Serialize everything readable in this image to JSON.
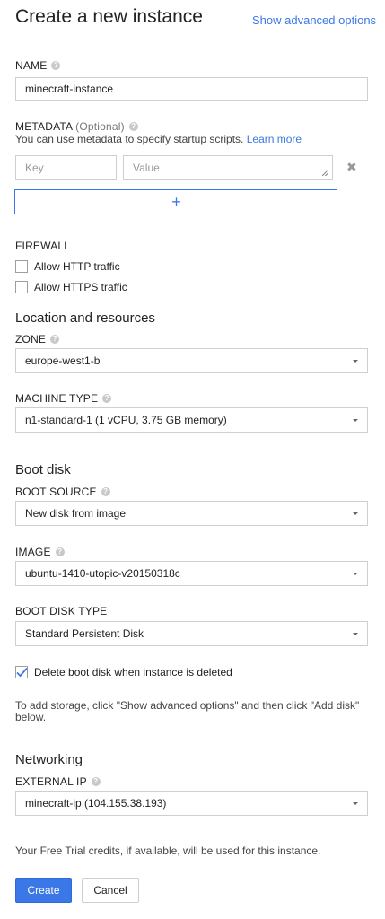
{
  "header": {
    "title": "Create a new instance",
    "advanced_link": "Show advanced options"
  },
  "name": {
    "label": "NAME",
    "value": "minecraft-instance"
  },
  "metadata": {
    "label": "METADATA",
    "optional": "(Optional)",
    "description": "You can use metadata to specify startup scripts.",
    "learn_more": "Learn more",
    "key_placeholder": "Key",
    "value_placeholder": "Value",
    "add_symbol": "+"
  },
  "firewall": {
    "label": "FIREWALL",
    "http_label": "Allow HTTP traffic",
    "http_checked": false,
    "https_label": "Allow HTTPS traffic",
    "https_checked": false
  },
  "location": {
    "heading": "Location and resources",
    "zone_label": "ZONE",
    "zone_value": "europe-west1-b",
    "machine_type_label": "MACHINE TYPE",
    "machine_type_value": "n1-standard-1 (1 vCPU, 3.75 GB memory)"
  },
  "boot_disk": {
    "heading": "Boot disk",
    "source_label": "BOOT SOURCE",
    "source_value": "New disk from image",
    "image_label": "IMAGE",
    "image_value": "ubuntu-1410-utopic-v20150318c",
    "type_label": "BOOT DISK TYPE",
    "type_value": "Standard Persistent Disk",
    "delete_label": "Delete boot disk when instance is deleted",
    "delete_checked": true
  },
  "storage_note": "To add storage, click \"Show advanced options\" and then click \"Add disk\" below.",
  "networking": {
    "heading": "Networking",
    "external_ip_label": "EXTERNAL IP",
    "external_ip_value": "minecraft-ip (104.155.38.193)"
  },
  "trial_note": "Your Free Trial credits, if available, will be used for this instance.",
  "actions": {
    "create": "Create",
    "cancel": "Cancel"
  },
  "icons": {
    "help": "help-icon",
    "remove": "close-icon",
    "dropdown": "caret-down-icon",
    "check": "checkmark-icon"
  },
  "colors": {
    "accent": "#3b78e7",
    "border": "#cfcfcf"
  }
}
